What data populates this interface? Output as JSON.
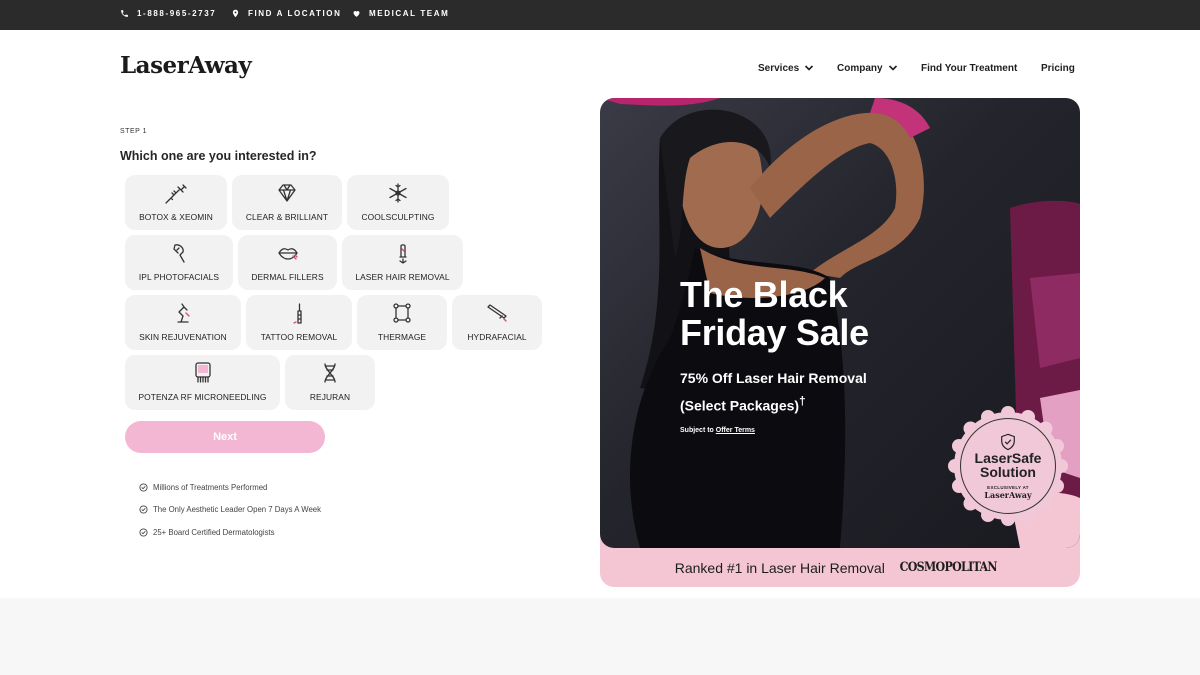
{
  "topbar": {
    "phone": "1-888-965-2737",
    "location": "FIND A LOCATION",
    "team": "MEDICAL TEAM"
  },
  "header": {
    "logo": "LaserAway",
    "nav": {
      "services": "Services",
      "company": "Company",
      "find_treatment": "Find Your Treatment",
      "pricing": "Pricing"
    }
  },
  "form": {
    "step": "STEP 1",
    "question": "Which one are you interested in?",
    "options": [
      {
        "label": "BOTOX & XEOMIN",
        "icon": "syringe-icon"
      },
      {
        "label": "CLEAR & BRILLIANT",
        "icon": "diamond-icon"
      },
      {
        "label": "COOLSCULPTING",
        "icon": "snowflake-icon"
      },
      {
        "label": "IPL PHOTOFACIALS",
        "icon": "handpiece-icon"
      },
      {
        "label": "DERMAL FILLERS",
        "icon": "lips-icon"
      },
      {
        "label": "LASER HAIR REMOVAL",
        "icon": "laser-icon"
      },
      {
        "label": "SKIN REJUVENATION",
        "icon": "laser-arm-icon"
      },
      {
        "label": "TATTOO REMOVAL",
        "icon": "tattoo-pen-icon"
      },
      {
        "label": "THERMAGE",
        "icon": "nodes-icon"
      },
      {
        "label": "HYDRAFACIAL",
        "icon": "wand-icon"
      },
      {
        "label": "POTENZA RF MICRONEEDLING",
        "icon": "microneedle-icon"
      },
      {
        "label": "REJURAN",
        "icon": "dna-icon"
      }
    ],
    "next": "Next",
    "features": [
      "Millions of Treatments Performed",
      "The Only Aesthetic Leader Open 7 Days A Week",
      "25+ Board Certified Dermatologists"
    ]
  },
  "hero": {
    "headline_1": "The Black",
    "headline_2": "Friday Sale",
    "offer_1": "75% Off Laser Hair Removal",
    "offer_2": "(Select Packages)",
    "offer_mark": "†",
    "terms_prefix": "Subject to ",
    "terms_link": "Offer Terms",
    "badge_title_1": "LaserSafe",
    "badge_title_2": "Solution",
    "badge_sub": "EXCLUSIVELY AT",
    "badge_logo": "LaserAway",
    "ranked": "Ranked #1 in Laser Hair Removal",
    "ranked_logo": "COSMOPOLITAN"
  },
  "colors": {
    "accent_pink": "#f3b7d3",
    "topbar": "#2b2b2b",
    "ranked_bg": "#f4c6d4"
  }
}
